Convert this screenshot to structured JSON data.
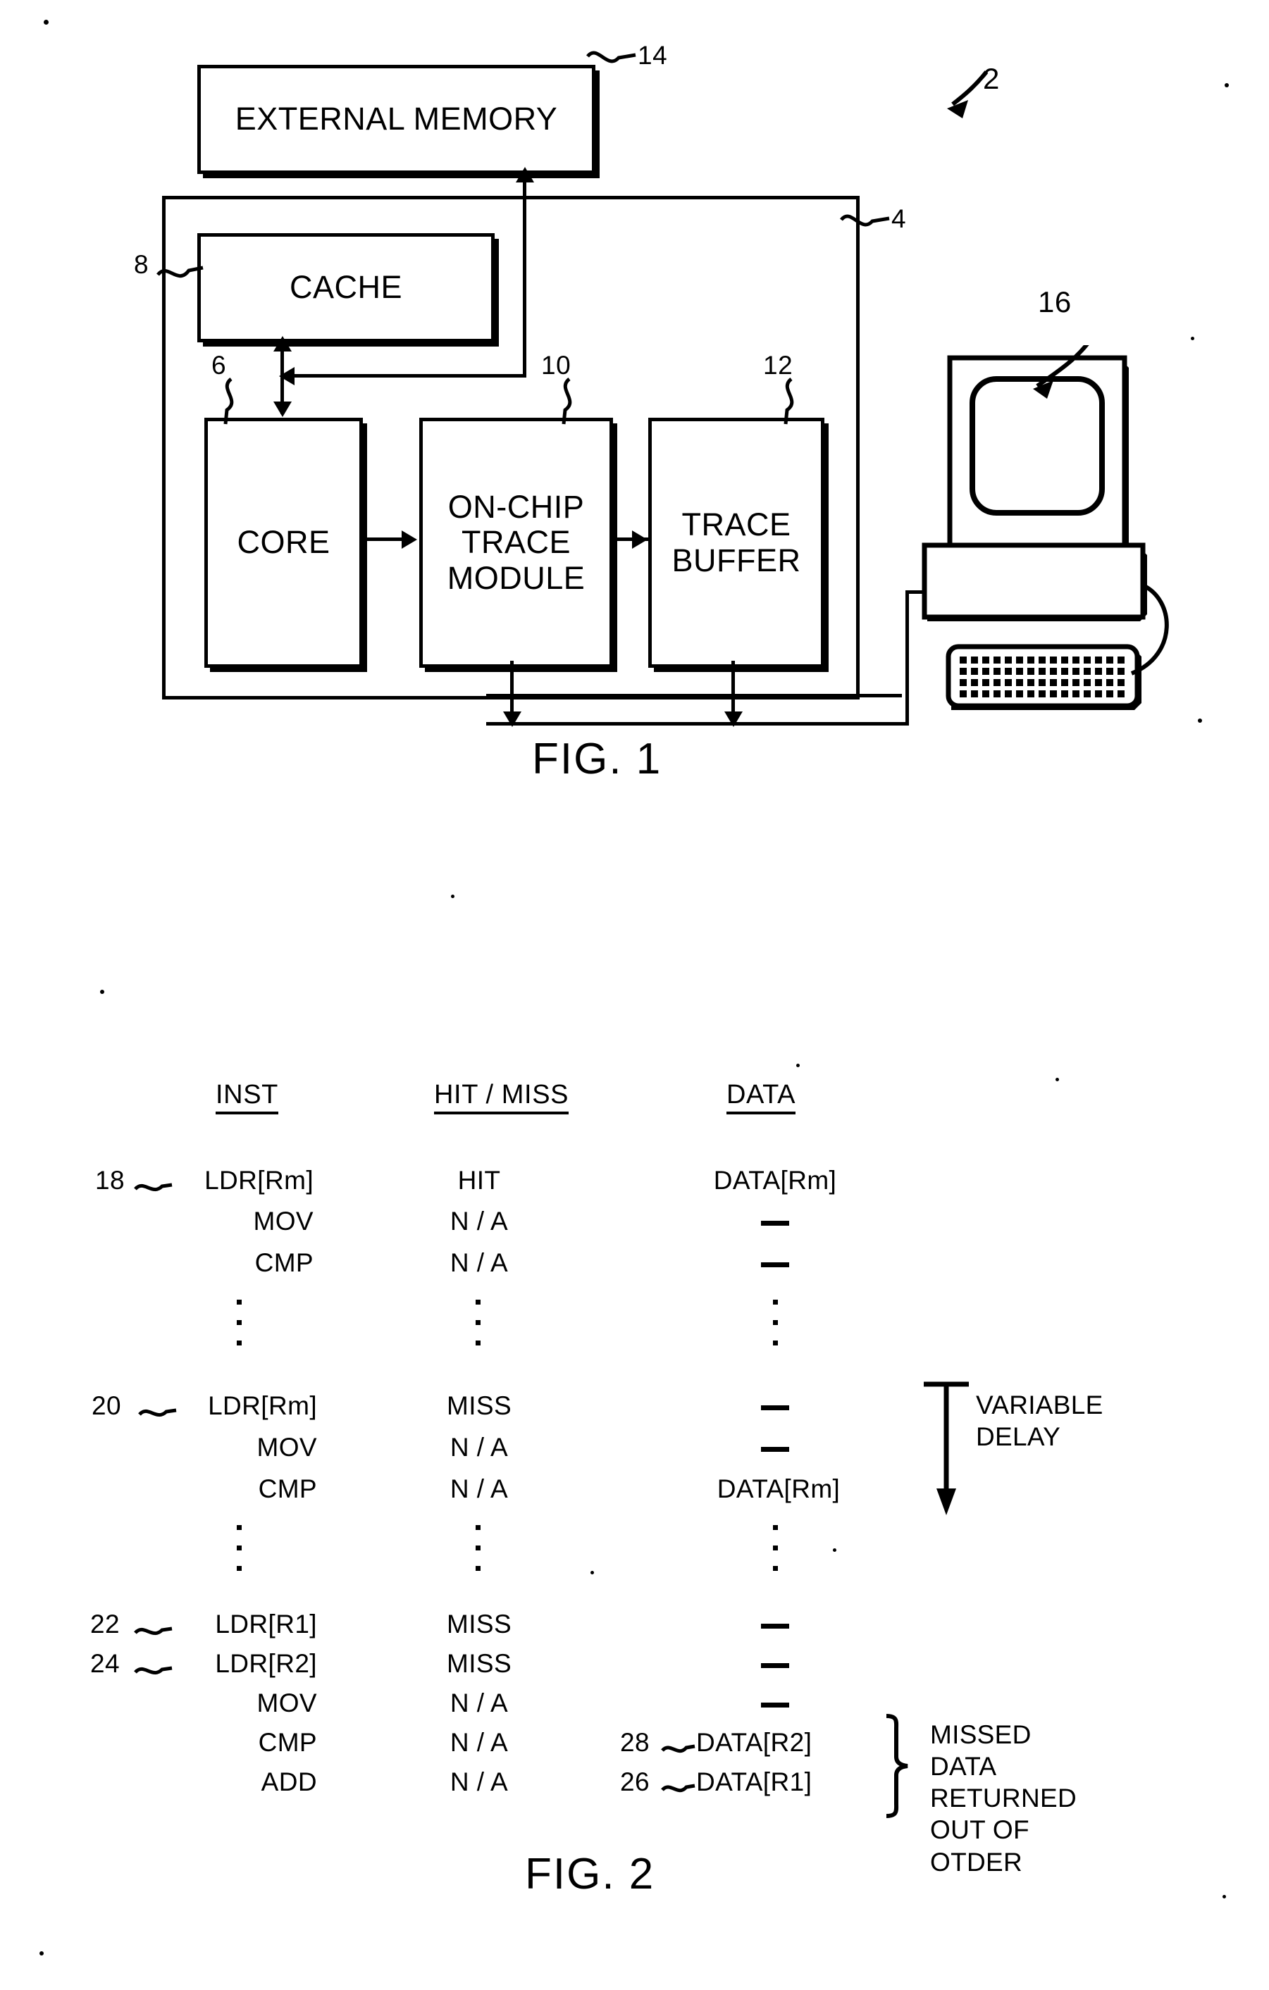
{
  "figure1": {
    "caption": "FIG. 1",
    "blocks": {
      "external_memory": "EXTERNAL MEMORY",
      "cache": "CACHE",
      "core": "CORE",
      "trace_module": "ON-CHIP\nTRACE\nMODULE",
      "trace_buffer": "TRACE\nBUFFER"
    },
    "ref_numbers": {
      "system": "2",
      "chip": "4",
      "core": "6",
      "cache": "8",
      "trace_module": "10",
      "trace_buffer": "12",
      "external_memory": "14",
      "computer": "16"
    }
  },
  "figure2": {
    "caption": "FIG. 2",
    "headers": [
      "INST",
      "HIT / MISS",
      "DATA"
    ],
    "groups": [
      {
        "rows": [
          {
            "ref": "18",
            "inst": "LDR[Rm]",
            "hitmiss": "HIT",
            "data": "DATA[Rm]",
            "data_type": "text"
          },
          {
            "ref": "",
            "inst": "MOV",
            "hitmiss": "N / A",
            "data": "",
            "data_type": "dash"
          },
          {
            "ref": "",
            "inst": "CMP",
            "hitmiss": "N / A",
            "data": "",
            "data_type": "dash"
          }
        ]
      },
      {
        "rows": [
          {
            "ref": "20",
            "inst": "LDR[Rm]",
            "hitmiss": "MISS",
            "data": "",
            "data_type": "dash"
          },
          {
            "ref": "",
            "inst": "MOV",
            "hitmiss": "N / A",
            "data": "",
            "data_type": "dash"
          },
          {
            "ref": "",
            "inst": "CMP",
            "hitmiss": "N / A",
            "data": "DATA[Rm]",
            "data_type": "text"
          }
        ]
      },
      {
        "rows": [
          {
            "ref": "22",
            "inst": "LDR[R1]",
            "hitmiss": "MISS",
            "data": "",
            "data_type": "dash"
          },
          {
            "ref": "24",
            "inst": "LDR[R2]",
            "hitmiss": "MISS",
            "data": "",
            "data_type": "dash"
          },
          {
            "ref": "",
            "inst": "MOV",
            "hitmiss": "N / A",
            "data": "",
            "data_type": "dash"
          },
          {
            "ref": "",
            "inst": "CMP",
            "hitmiss": "N / A",
            "data": "DATA[R2]",
            "data_ref": "28",
            "data_type": "text"
          },
          {
            "ref": "",
            "inst": "ADD",
            "hitmiss": "N / A",
            "data": "DATA[R1]",
            "data_ref": "26",
            "data_type": "text"
          }
        ]
      }
    ],
    "annotations": {
      "variable_delay": "VARIABLE\nDELAY",
      "out_of_order": "MISSED DATA\nRETURNED\nOUT OF OTDER"
    }
  }
}
